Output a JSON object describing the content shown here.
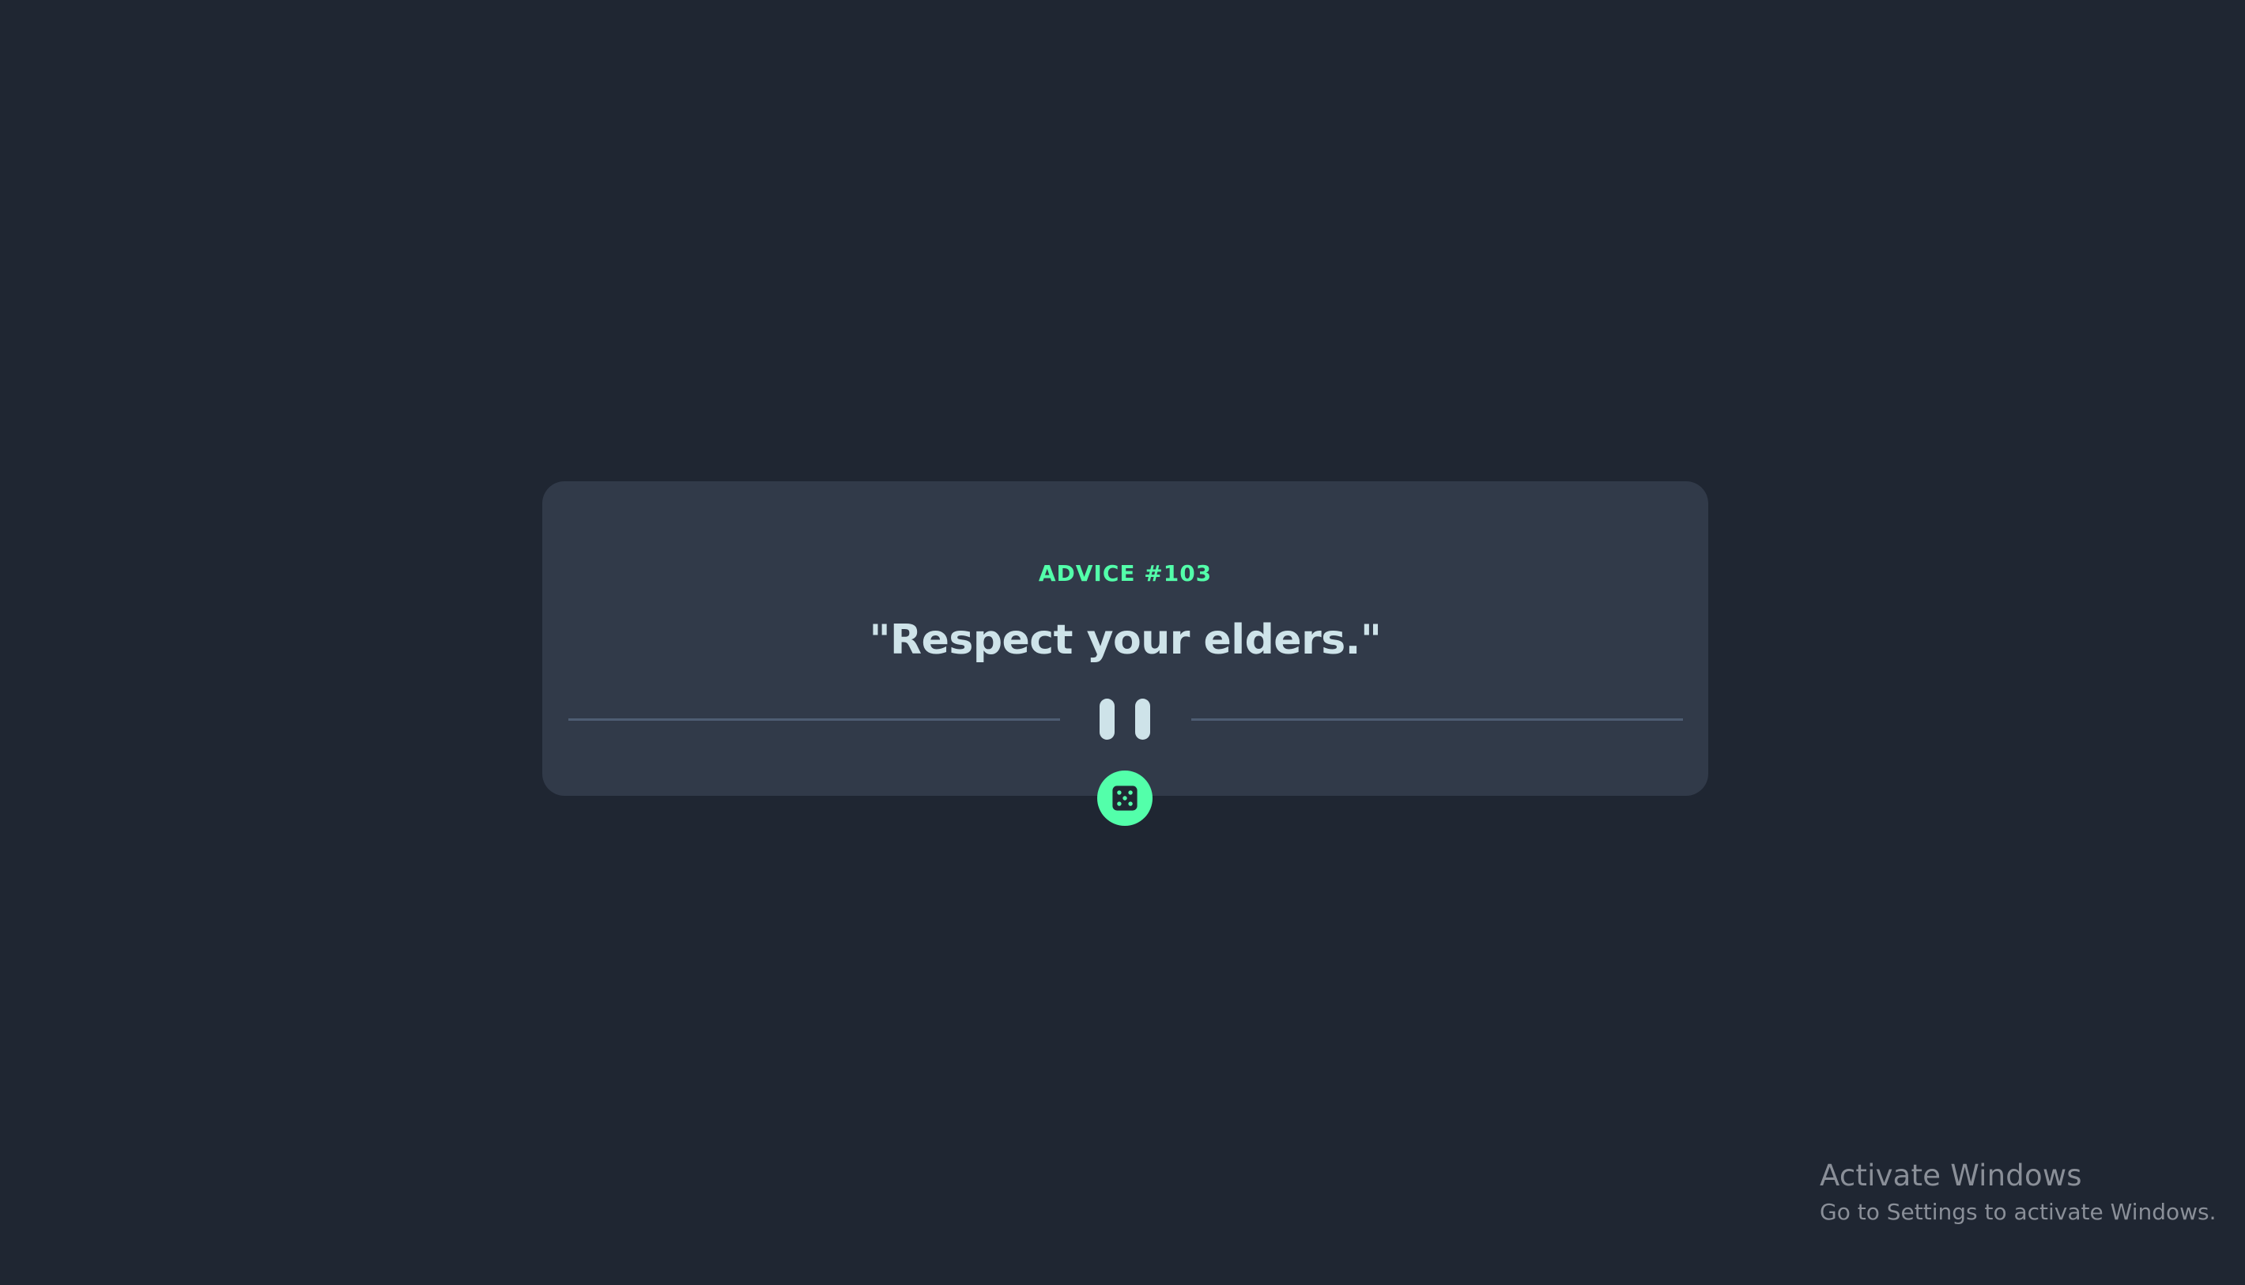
{
  "card": {
    "advice_id": "ADVICE #103",
    "advice_text": "\"Respect your elders.\""
  },
  "icons": {
    "divider_icon": "pause-icon",
    "button_icon": "dice-icon"
  },
  "watermark": {
    "title": "Activate Windows",
    "subtitle": "Go to Settings to activate Windows."
  },
  "colors": {
    "background": "#1f2632",
    "card": "#313a49",
    "accent": "#53ffaa",
    "text": "#cee3e9",
    "divider": "#4e5d73"
  }
}
